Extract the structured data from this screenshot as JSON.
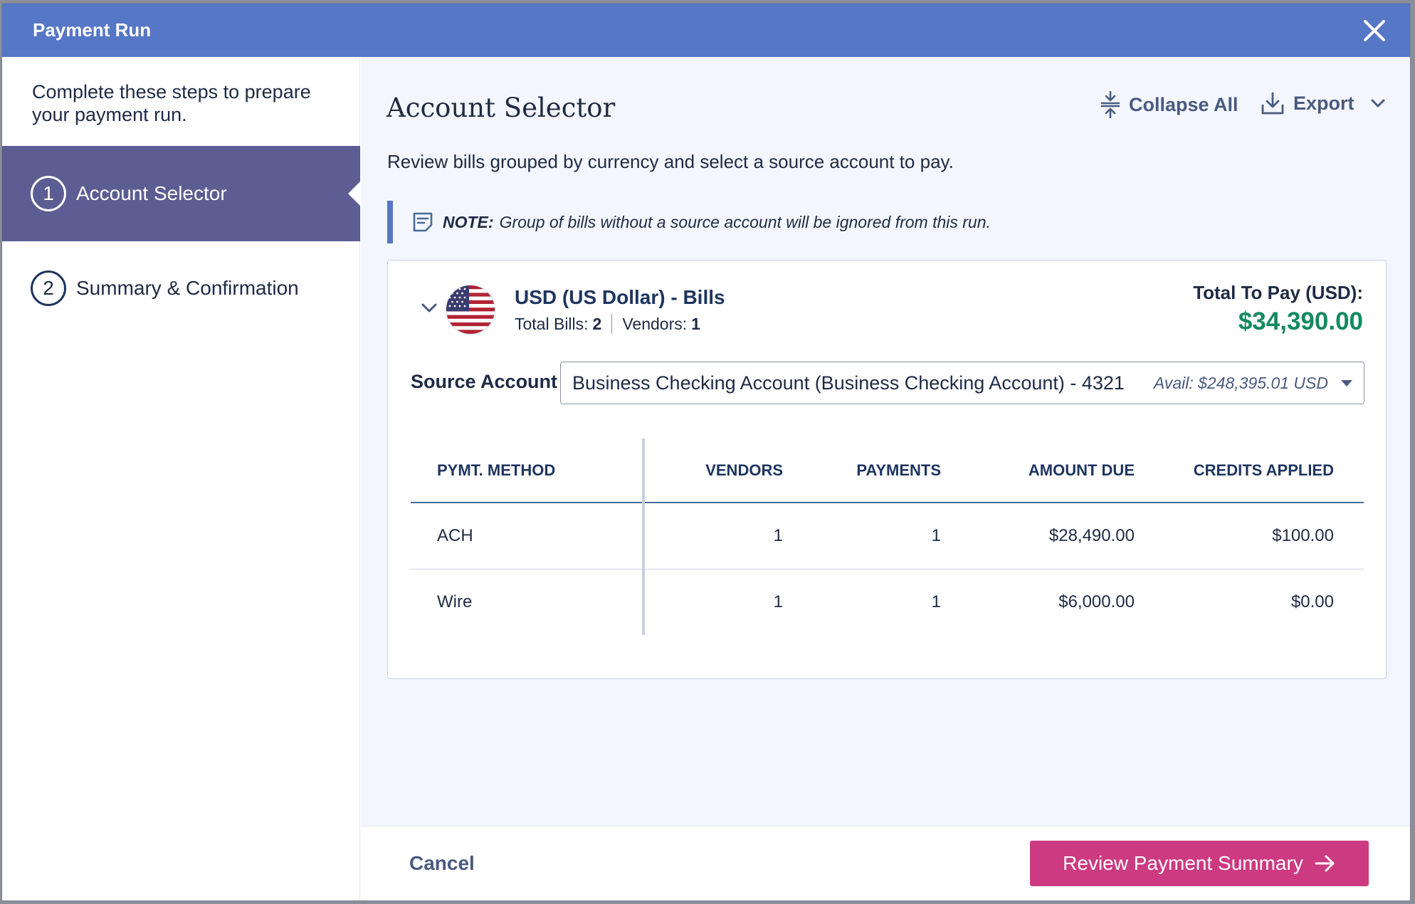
{
  "window": {
    "title": "Payment Run"
  },
  "sidebar": {
    "intro": "Complete these steps to prepare your payment run.",
    "steps": [
      {
        "number": "1",
        "label": "Account Selector",
        "active": true
      },
      {
        "number": "2",
        "label": "Summary & Confirmation",
        "active": false
      }
    ]
  },
  "main": {
    "title": "Account Selector",
    "subtitle": "Review bills grouped by currency and select a source account to pay.",
    "toolbar": {
      "collapse_label": "Collapse All",
      "export_label": "Export"
    },
    "note": {
      "label": "NOTE:",
      "text": "Group of bills without a source account will be ignored from this run."
    },
    "group": {
      "title": "USD (US Dollar) - Bills",
      "total_bills_label": "Total Bills:",
      "total_bills": "2",
      "vendors_label": "Vendors:",
      "vendors": "1",
      "total_label": "Total To Pay (USD):",
      "total_value": "$34,390.00",
      "source_label": "Source Account",
      "source_value": "Business Checking Account (Business Checking Account) - 4321",
      "source_avail": "Avail: $248,395.01 USD",
      "table": {
        "headers": [
          "PYMT. METHOD",
          "VENDORS",
          "PAYMENTS",
          "AMOUNT DUE",
          "CREDITS APPLIED"
        ],
        "rows": [
          [
            "ACH",
            "1",
            "1",
            "$28,490.00",
            "$100.00"
          ],
          [
            "Wire",
            "1",
            "1",
            "$6,000.00",
            "$0.00"
          ]
        ]
      }
    }
  },
  "footer": {
    "cancel_label": "Cancel",
    "primary_label": "Review Payment Summary"
  },
  "colors": {
    "header": "#5676c6",
    "active_step": "#5c5d93",
    "total_green": "#138a5e",
    "primary_button": "#cc3a81"
  },
  "icons": {
    "close": "close-icon",
    "collapse": "collapse-all-icon",
    "export": "download-icon",
    "note": "note-icon",
    "flag": "us-flag-icon",
    "arrow": "arrow-right-icon"
  }
}
